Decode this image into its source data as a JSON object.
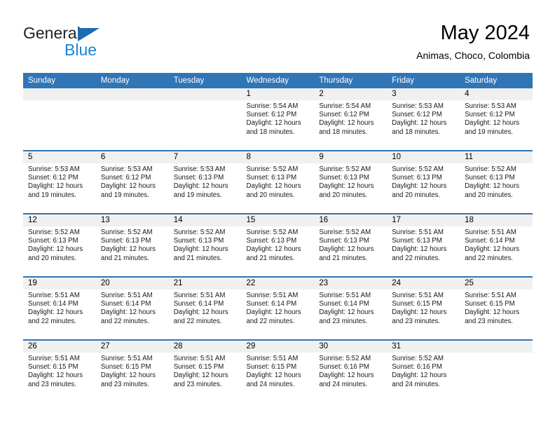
{
  "brand": {
    "name_top": "General",
    "name_bottom": "Blue",
    "triangle_color": "#1b6cb5",
    "text_color": "#231f20",
    "blue_color": "#1b83d4"
  },
  "header": {
    "title": "May 2024",
    "subtitle": "Animas, Choco, Colombia"
  },
  "theme": {
    "header_row_bg": "#3075b5",
    "daynum_bg": "#f0f0f0",
    "row_separator": "#3075b5"
  },
  "weekdays": [
    "Sunday",
    "Monday",
    "Tuesday",
    "Wednesday",
    "Thursday",
    "Friday",
    "Saturday"
  ],
  "weeks": [
    [
      {
        "day": "",
        "sunrise": "",
        "sunset": "",
        "daylight_line1": "",
        "daylight_line2": ""
      },
      {
        "day": "",
        "sunrise": "",
        "sunset": "",
        "daylight_line1": "",
        "daylight_line2": ""
      },
      {
        "day": "",
        "sunrise": "",
        "sunset": "",
        "daylight_line1": "",
        "daylight_line2": ""
      },
      {
        "day": "1",
        "sunrise": "Sunrise: 5:54 AM",
        "sunset": "Sunset: 6:12 PM",
        "daylight_line1": "Daylight: 12 hours",
        "daylight_line2": "and 18 minutes."
      },
      {
        "day": "2",
        "sunrise": "Sunrise: 5:54 AM",
        "sunset": "Sunset: 6:12 PM",
        "daylight_line1": "Daylight: 12 hours",
        "daylight_line2": "and 18 minutes."
      },
      {
        "day": "3",
        "sunrise": "Sunrise: 5:53 AM",
        "sunset": "Sunset: 6:12 PM",
        "daylight_line1": "Daylight: 12 hours",
        "daylight_line2": "and 18 minutes."
      },
      {
        "day": "4",
        "sunrise": "Sunrise: 5:53 AM",
        "sunset": "Sunset: 6:12 PM",
        "daylight_line1": "Daylight: 12 hours",
        "daylight_line2": "and 19 minutes."
      }
    ],
    [
      {
        "day": "5",
        "sunrise": "Sunrise: 5:53 AM",
        "sunset": "Sunset: 6:12 PM",
        "daylight_line1": "Daylight: 12 hours",
        "daylight_line2": "and 19 minutes."
      },
      {
        "day": "6",
        "sunrise": "Sunrise: 5:53 AM",
        "sunset": "Sunset: 6:12 PM",
        "daylight_line1": "Daylight: 12 hours",
        "daylight_line2": "and 19 minutes."
      },
      {
        "day": "7",
        "sunrise": "Sunrise: 5:53 AM",
        "sunset": "Sunset: 6:13 PM",
        "daylight_line1": "Daylight: 12 hours",
        "daylight_line2": "and 19 minutes."
      },
      {
        "day": "8",
        "sunrise": "Sunrise: 5:52 AM",
        "sunset": "Sunset: 6:13 PM",
        "daylight_line1": "Daylight: 12 hours",
        "daylight_line2": "and 20 minutes."
      },
      {
        "day": "9",
        "sunrise": "Sunrise: 5:52 AM",
        "sunset": "Sunset: 6:13 PM",
        "daylight_line1": "Daylight: 12 hours",
        "daylight_line2": "and 20 minutes."
      },
      {
        "day": "10",
        "sunrise": "Sunrise: 5:52 AM",
        "sunset": "Sunset: 6:13 PM",
        "daylight_line1": "Daylight: 12 hours",
        "daylight_line2": "and 20 minutes."
      },
      {
        "day": "11",
        "sunrise": "Sunrise: 5:52 AM",
        "sunset": "Sunset: 6:13 PM",
        "daylight_line1": "Daylight: 12 hours",
        "daylight_line2": "and 20 minutes."
      }
    ],
    [
      {
        "day": "12",
        "sunrise": "Sunrise: 5:52 AM",
        "sunset": "Sunset: 6:13 PM",
        "daylight_line1": "Daylight: 12 hours",
        "daylight_line2": "and 20 minutes."
      },
      {
        "day": "13",
        "sunrise": "Sunrise: 5:52 AM",
        "sunset": "Sunset: 6:13 PM",
        "daylight_line1": "Daylight: 12 hours",
        "daylight_line2": "and 21 minutes."
      },
      {
        "day": "14",
        "sunrise": "Sunrise: 5:52 AM",
        "sunset": "Sunset: 6:13 PM",
        "daylight_line1": "Daylight: 12 hours",
        "daylight_line2": "and 21 minutes."
      },
      {
        "day": "15",
        "sunrise": "Sunrise: 5:52 AM",
        "sunset": "Sunset: 6:13 PM",
        "daylight_line1": "Daylight: 12 hours",
        "daylight_line2": "and 21 minutes."
      },
      {
        "day": "16",
        "sunrise": "Sunrise: 5:52 AM",
        "sunset": "Sunset: 6:13 PM",
        "daylight_line1": "Daylight: 12 hours",
        "daylight_line2": "and 21 minutes."
      },
      {
        "day": "17",
        "sunrise": "Sunrise: 5:51 AM",
        "sunset": "Sunset: 6:13 PM",
        "daylight_line1": "Daylight: 12 hours",
        "daylight_line2": "and 22 minutes."
      },
      {
        "day": "18",
        "sunrise": "Sunrise: 5:51 AM",
        "sunset": "Sunset: 6:14 PM",
        "daylight_line1": "Daylight: 12 hours",
        "daylight_line2": "and 22 minutes."
      }
    ],
    [
      {
        "day": "19",
        "sunrise": "Sunrise: 5:51 AM",
        "sunset": "Sunset: 6:14 PM",
        "daylight_line1": "Daylight: 12 hours",
        "daylight_line2": "and 22 minutes."
      },
      {
        "day": "20",
        "sunrise": "Sunrise: 5:51 AM",
        "sunset": "Sunset: 6:14 PM",
        "daylight_line1": "Daylight: 12 hours",
        "daylight_line2": "and 22 minutes."
      },
      {
        "day": "21",
        "sunrise": "Sunrise: 5:51 AM",
        "sunset": "Sunset: 6:14 PM",
        "daylight_line1": "Daylight: 12 hours",
        "daylight_line2": "and 22 minutes."
      },
      {
        "day": "22",
        "sunrise": "Sunrise: 5:51 AM",
        "sunset": "Sunset: 6:14 PM",
        "daylight_line1": "Daylight: 12 hours",
        "daylight_line2": "and 22 minutes."
      },
      {
        "day": "23",
        "sunrise": "Sunrise: 5:51 AM",
        "sunset": "Sunset: 6:14 PM",
        "daylight_line1": "Daylight: 12 hours",
        "daylight_line2": "and 23 minutes."
      },
      {
        "day": "24",
        "sunrise": "Sunrise: 5:51 AM",
        "sunset": "Sunset: 6:15 PM",
        "daylight_line1": "Daylight: 12 hours",
        "daylight_line2": "and 23 minutes."
      },
      {
        "day": "25",
        "sunrise": "Sunrise: 5:51 AM",
        "sunset": "Sunset: 6:15 PM",
        "daylight_line1": "Daylight: 12 hours",
        "daylight_line2": "and 23 minutes."
      }
    ],
    [
      {
        "day": "26",
        "sunrise": "Sunrise: 5:51 AM",
        "sunset": "Sunset: 6:15 PM",
        "daylight_line1": "Daylight: 12 hours",
        "daylight_line2": "and 23 minutes."
      },
      {
        "day": "27",
        "sunrise": "Sunrise: 5:51 AM",
        "sunset": "Sunset: 6:15 PM",
        "daylight_line1": "Daylight: 12 hours",
        "daylight_line2": "and 23 minutes."
      },
      {
        "day": "28",
        "sunrise": "Sunrise: 5:51 AM",
        "sunset": "Sunset: 6:15 PM",
        "daylight_line1": "Daylight: 12 hours",
        "daylight_line2": "and 23 minutes."
      },
      {
        "day": "29",
        "sunrise": "Sunrise: 5:51 AM",
        "sunset": "Sunset: 6:15 PM",
        "daylight_line1": "Daylight: 12 hours",
        "daylight_line2": "and 24 minutes."
      },
      {
        "day": "30",
        "sunrise": "Sunrise: 5:52 AM",
        "sunset": "Sunset: 6:16 PM",
        "daylight_line1": "Daylight: 12 hours",
        "daylight_line2": "and 24 minutes."
      },
      {
        "day": "31",
        "sunrise": "Sunrise: 5:52 AM",
        "sunset": "Sunset: 6:16 PM",
        "daylight_line1": "Daylight: 12 hours",
        "daylight_line2": "and 24 minutes."
      },
      {
        "day": "",
        "sunrise": "",
        "sunset": "",
        "daylight_line1": "",
        "daylight_line2": ""
      }
    ]
  ]
}
